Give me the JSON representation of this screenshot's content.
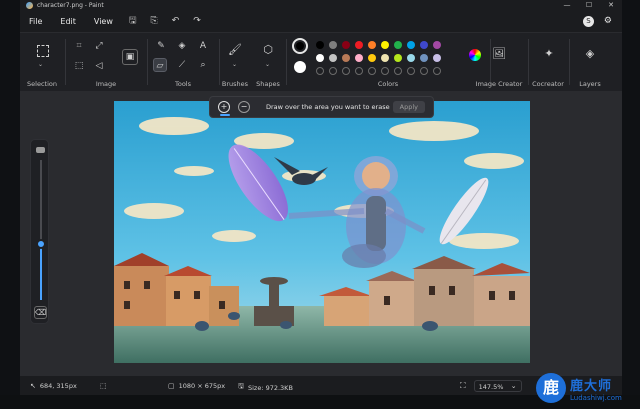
{
  "window": {
    "title": "character7.png - Paint",
    "controls": [
      "—",
      "☐",
      "✕"
    ]
  },
  "menu": {
    "items": [
      "File",
      "Edit",
      "View"
    ]
  },
  "account": {
    "initial": "S"
  },
  "ribbon": {
    "groups": {
      "selection": "Selection",
      "image": "Image",
      "tools": "Tools",
      "brushes": "Brushes",
      "shapes": "Shapes",
      "colors": "Colors",
      "image_creator": "Image Creator",
      "cocreator": "Cocreator",
      "layers": "Layers"
    },
    "tools_text_icon": "A",
    "palette_row1": [
      "#000000",
      "#7f7f7f",
      "#880015",
      "#ed1c24",
      "#ff7f27",
      "#fff200",
      "#22b14c",
      "#00a2e8",
      "#3f48cc",
      "#a349a4"
    ],
    "palette_row2": [
      "#ffffff",
      "#c3c3c3",
      "#b97a57",
      "#ffaec9",
      "#ffc90e",
      "#efe4b0",
      "#b5e61d",
      "#99d9ea",
      "#7092be",
      "#c8bfe7"
    ],
    "primary_color": "#000000",
    "secondary_color": "#ffffff"
  },
  "erase_bar": {
    "instruction": "Draw over the area you want to erase",
    "apply_label": "Apply"
  },
  "brush_size": {
    "level_fraction": 0.4
  },
  "status": {
    "cursor_pos": "684, 315px",
    "canvas_size": "1080 × 675px",
    "file_size": "Size: 972.3KB",
    "zoom": "147.5%"
  },
  "watermark": {
    "name": "鹿大师",
    "url": "Ludashiwj.com",
    "logo_char": "鹿"
  }
}
